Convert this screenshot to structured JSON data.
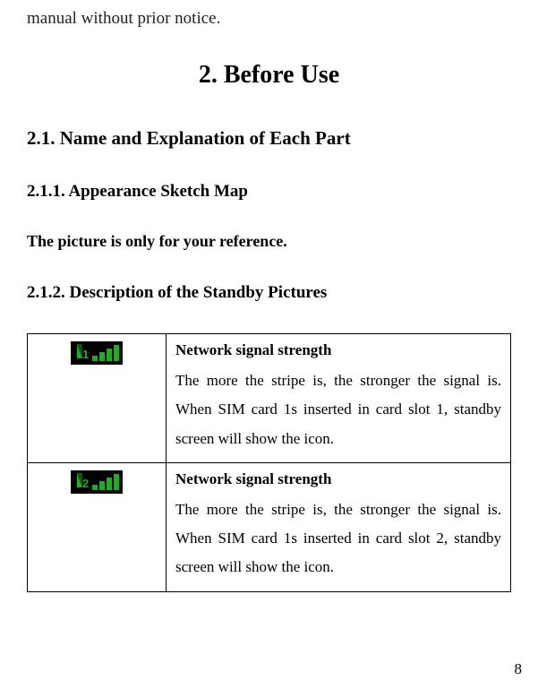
{
  "intro_fragment": "manual without prior notice.",
  "chapter": "2.   Before Use",
  "section_2_1": "2.1.    Name and Explanation of Each Part",
  "section_2_1_1": "2.1.1.     Appearance Sketch Map",
  "reference_note": "The picture is only for your reference.",
  "section_2_1_2": "2.1.2.     Description of the Standby Pictures",
  "table": {
    "row1": {
      "icon_name": "signal-strength-sim1-icon",
      "title": "Network signal strength",
      "body": "The more the stripe is, the stronger the signal is. When SIM card 1s inserted in card slot 1, standby screen will show the icon."
    },
    "row2": {
      "icon_name": "signal-strength-sim2-icon",
      "title": "Network signal strength",
      "body": "The more the stripe is, the stronger the signal is. When SIM card 1s inserted in card slot 2, standby screen will show the icon."
    }
  },
  "page_number": "8"
}
